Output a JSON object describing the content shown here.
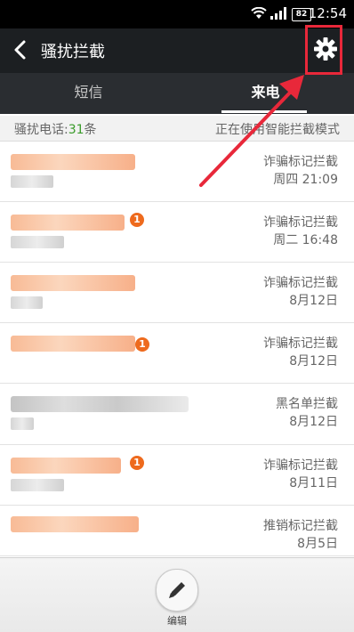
{
  "status": {
    "time": "12:54",
    "battery": "82"
  },
  "header": {
    "title": "骚扰拦截"
  },
  "tabs": [
    {
      "label": "短信"
    },
    {
      "label": "来电"
    }
  ],
  "info": {
    "count_prefix": "骚扰电话:",
    "count": "31",
    "count_suffix": "条",
    "mode": "正在使用智能拦截模式"
  },
  "rows": [
    {
      "badge": "",
      "type": "诈骗标记拦截",
      "date": "周四 21:09"
    },
    {
      "badge": "1",
      "type": "诈骗标记拦截",
      "date": "周二 16:48"
    },
    {
      "badge": "",
      "type": "诈骗标记拦截",
      "date": "8月12日"
    },
    {
      "badge": "1",
      "type": "诈骗标记拦截",
      "date": "8月12日"
    },
    {
      "badge": "",
      "type": "黑名单拦截",
      "date": "8月12日"
    },
    {
      "badge": "1",
      "type": "诈骗标记拦截",
      "date": "8月11日"
    },
    {
      "badge": "",
      "type": "推销标记拦截",
      "date": "8月5日"
    }
  ],
  "bottom": {
    "edit_label": "编辑"
  },
  "colors": {
    "accent_green": "#3a9b2a",
    "badge_orange": "#ee6a1d",
    "annotation_red": "#e8283a"
  }
}
